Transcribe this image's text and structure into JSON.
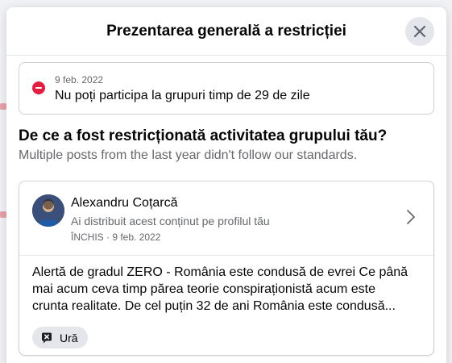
{
  "modal": {
    "title": "Prezentarea generală a restricției",
    "close_icon": "close-icon"
  },
  "restriction": {
    "icon": "stop-icon",
    "date": "9 feb. 2022",
    "text": "Nu poți participa la grupuri timp de 29 de zile"
  },
  "why": {
    "heading": "De ce a fost restricționată activitatea grupului tău?",
    "subtitle": "Multiple posts from the last year didn't follow our standards."
  },
  "post": {
    "author": "Alexandru Coțarcă",
    "shared_text": "Ai distribuit acest conținut pe profilul tău",
    "meta": "ÎNCHIS · 9 feb. 2022",
    "body_lines": [
      "Alertă de gradul ZERO - România este condusă de evrei Ce până",
      "mai acum ceva timp părea teorie conspiraționistă acum este",
      "crunta realitate. De cel puțin 32 de ani România este condusă..."
    ],
    "tag": {
      "icon": "hate-speech-icon",
      "label": "Ură"
    }
  },
  "colors": {
    "accent_red": "#e41e3f",
    "secondary_text": "#65676b",
    "pill_bg": "#e4e6eb"
  }
}
